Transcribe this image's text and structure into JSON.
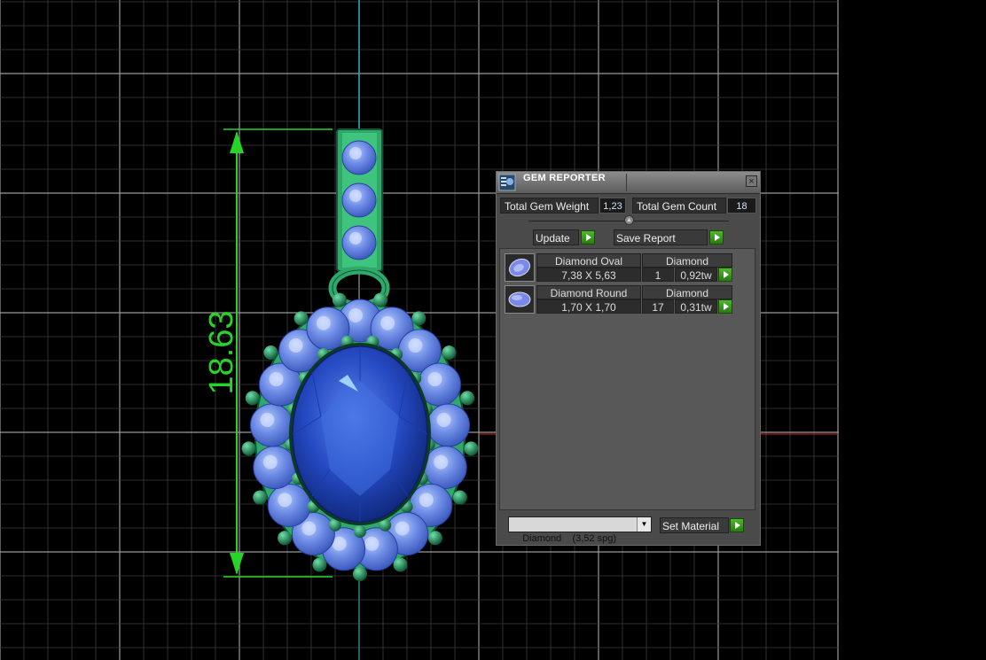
{
  "viewport": {
    "dimension_label": "18.63",
    "colors": {
      "grid": "#8a8a8a",
      "gem": "#3a5fcf",
      "metal": "#2fa86a",
      "dimension": "#28d428"
    }
  },
  "gem_reporter": {
    "title": "GEM REPORTER",
    "close_label": "×",
    "total_gem_weight_label": "Total Gem Weight",
    "total_gem_weight_value": "1,23",
    "total_gem_count_label": "Total Gem Count",
    "total_gem_count_value": "18",
    "update_label": "Update",
    "save_report_label": "Save Report",
    "gems": [
      {
        "shape": "Diamond Oval",
        "material": "Diamond",
        "size": "7,38 X 5,63",
        "count": "1",
        "weight": "0,92tw",
        "icon": "oval-gem-icon"
      },
      {
        "shape": "Diamond Round",
        "material": "Diamond",
        "size": "1,70 X 1,70",
        "count": "17",
        "weight": "0,31tw",
        "icon": "round-gem-icon"
      }
    ],
    "material_select_value": "Diamond    (3,52 spg)",
    "set_material_label": "Set Material"
  }
}
